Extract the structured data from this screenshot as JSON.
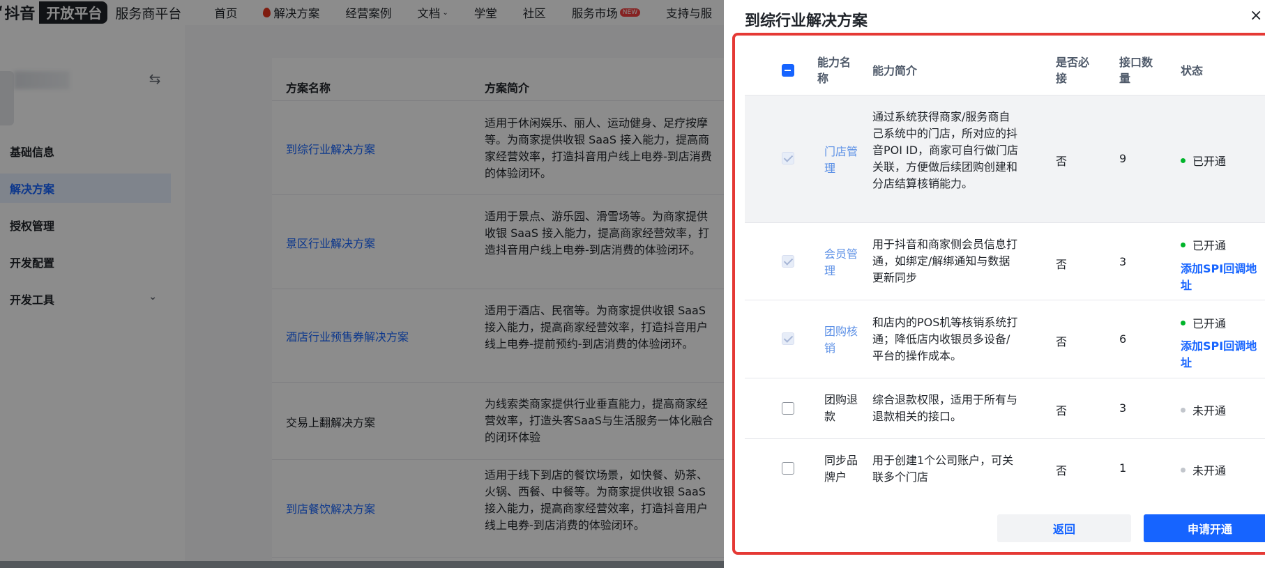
{
  "logo": {
    "mark": "‘",
    "brand": "抖音",
    "badge": "开放平台",
    "sub": "服务商平台"
  },
  "nav": [
    {
      "label": "首页"
    },
    {
      "label": "解决方案",
      "icon": "flame-icon"
    },
    {
      "label": "经营案例"
    },
    {
      "label": "文档",
      "chevron": "⌄"
    },
    {
      "label": "学堂"
    },
    {
      "label": "社区"
    },
    {
      "label": "服务市场",
      "badge": "NEW"
    },
    {
      "label": "支持与服"
    }
  ],
  "sidebar": {
    "swap_icon": "⇆",
    "items": [
      {
        "label": "基础信息"
      },
      {
        "label": "解决方案",
        "active": true
      },
      {
        "label": "授权管理"
      },
      {
        "label": "开发配置"
      },
      {
        "label": "开发工具",
        "chevron": "⌄"
      }
    ]
  },
  "main": {
    "headers": {
      "name": "方案名称",
      "desc": "方案简介"
    },
    "rows": [
      {
        "name": "到综行业解决方案",
        "desc": "适用于休闲娱乐、丽人、运动健身、足疗按摩等。为商家提供收银 SaaS 接入能力，提高商家经营效率，打造抖音用户线上电券-到店消费的体验闭环。"
      },
      {
        "name": "景区行业解决方案",
        "desc": "适用于景点、游乐园、滑雪场等。为商家提供收银 SaaS 接入能力，提高商家经营效率，打造抖音用户线上电券-到店消费的体验闭环。"
      },
      {
        "name": "酒店行业预售券解决方案",
        "desc": "适用于酒店、民宿等。为商家提供收银 SaaS 接入能力，提高商家经营效率，打造抖音用户线上电券-提前预约-到店消费的体验闭环。"
      },
      {
        "name": "交易上翻解决方案",
        "desc": "为线索类商家提供行业垂直能力，提高商家经营效率，打造头客SaaS与生活服务一体化融合的闭环体验"
      },
      {
        "name": "到店餐饮解决方案",
        "desc": "适用于线下到店的餐饮场景，如快餐、奶茶、火锅、西餐、中餐等。为商家提供收银 SaaS 接入能力，提高商家经营效率，打造抖音用户线上电券-到店消费的体验闭环。"
      }
    ]
  },
  "drawer": {
    "title": "到综行业解决方案",
    "close": "×",
    "headers": {
      "name": "能力名称",
      "desc": "能力简介",
      "required": "是否必接",
      "count": "接口数量",
      "status": "状态"
    },
    "rows": [
      {
        "name": "门店管理",
        "desc": "通过系统获得商家/服务商自己系统中的门店，所对应的抖音POI ID，商家可自行做门店关联，方便做后续团购创建和分店结算核销能力。",
        "required": "否",
        "count": "9",
        "status": "已开通",
        "enabled": true,
        "spi": ""
      },
      {
        "name": "会员管理",
        "desc": "用于抖音和商家侧会员信息打通，如绑定/解绑通知与数据更新同步",
        "required": "否",
        "count": "3",
        "status": "已开通",
        "enabled": true,
        "spi": "添加SPI回调地址"
      },
      {
        "name": "团购核销",
        "desc": "和店内的POS机等核销系统打通；降低店内收银员多设备/平台的操作成本。",
        "required": "否",
        "count": "6",
        "status": "已开通",
        "enabled": true,
        "spi": "添加SPI回调地址"
      },
      {
        "name": "团购退款",
        "desc": "综合退款权限，适用于所有与退款相关的接口。",
        "required": "否",
        "count": "3",
        "status": "未开通",
        "enabled": false,
        "spi": ""
      },
      {
        "name": "同步品牌户",
        "desc": "用于创建1个公司账户，可关联多个门店",
        "required": "否",
        "count": "1",
        "status": "未开通",
        "enabled": false,
        "spi": ""
      }
    ],
    "back": "返回",
    "apply": "申请开通"
  }
}
